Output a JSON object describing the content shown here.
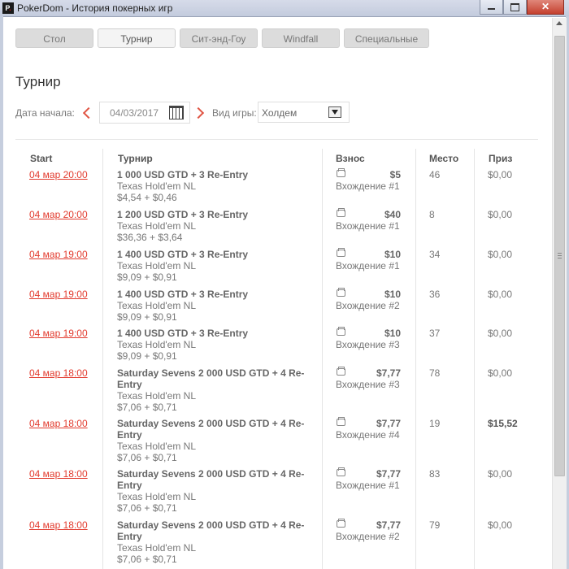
{
  "window": {
    "title": "PokerDom - История покерных игр",
    "close_label": "✕"
  },
  "tabs": [
    {
      "label": "Стол",
      "active": false
    },
    {
      "label": "Турнир",
      "active": true
    },
    {
      "label": "Сит-энд-Гоу",
      "active": false
    },
    {
      "label": "Windfall",
      "active": false
    },
    {
      "label": "Специальные",
      "active": false
    }
  ],
  "page_title": "Турнир",
  "filters": {
    "date_label": "Дата начала:",
    "date_value": "04/03/2017",
    "game_label": "Вид игры:",
    "game_value": "Холдем"
  },
  "table": {
    "headers": {
      "start": "Start",
      "tournament": "Турнир",
      "fee": "Взнос",
      "place": "Место",
      "prize": "Приз"
    },
    "rows": [
      {
        "start": "04 мар 20:00",
        "name": "1 000 USD GTD + 3 Re-Entry",
        "game": "Texas Hold'em NL",
        "buyin": "$4,54 + $0,46",
        "fee": "$5",
        "entry": "Вхождение #1",
        "place": "46",
        "prize": "$0,00"
      },
      {
        "start": "04 мар 20:00",
        "name": "1 200 USD GTD + 3 Re-Entry",
        "game": "Texas Hold'em NL",
        "buyin": "$36,36 + $3,64",
        "fee": "$40",
        "entry": "Вхождение #1",
        "place": "8",
        "prize": "$0,00"
      },
      {
        "start": "04 мар 19:00",
        "name": "1 400 USD GTD + 3 Re-Entry",
        "game": "Texas Hold'em NL",
        "buyin": "$9,09 + $0,91",
        "fee": "$10",
        "entry": "Вхождение #1",
        "place": "34",
        "prize": "$0,00"
      },
      {
        "start": "04 мар 19:00",
        "name": "1 400 USD GTD + 3 Re-Entry",
        "game": "Texas Hold'em NL",
        "buyin": "$9,09 + $0,91",
        "fee": "$10",
        "entry": "Вхождение #2",
        "place": "36",
        "prize": "$0,00"
      },
      {
        "start": "04 мар 19:00",
        "name": "1 400 USD GTD + 3 Re-Entry",
        "game": "Texas Hold'em NL",
        "buyin": "$9,09 + $0,91",
        "fee": "$10",
        "entry": "Вхождение #3",
        "place": "37",
        "prize": "$0,00"
      },
      {
        "start": "04 мар 18:00",
        "name": "Saturday Sevens 2 000 USD GTD + 4 Re-Entry",
        "game": "Texas Hold'em NL",
        "buyin": "$7,06 + $0,71",
        "fee": "$7,77",
        "entry": "Вхождение #3",
        "place": "78",
        "prize": "$0,00"
      },
      {
        "start": "04 мар 18:00",
        "name": "Saturday Sevens 2 000 USD GTD + 4 Re-Entry",
        "game": "Texas Hold'em NL",
        "buyin": "$7,06 + $0,71",
        "fee": "$7,77",
        "entry": "Вхождение #4",
        "place": "19",
        "prize": "$15,52"
      },
      {
        "start": "04 мар 18:00",
        "name": "Saturday Sevens 2 000 USD GTD + 4 Re-Entry",
        "game": "Texas Hold'em NL",
        "buyin": "$7,06 + $0,71",
        "fee": "$7,77",
        "entry": "Вхождение #1",
        "place": "83",
        "prize": "$0,00"
      },
      {
        "start": "04 мар 18:00",
        "name": "Saturday Sevens 2 000 USD GTD + 4 Re-Entry",
        "game": "Texas Hold'em NL",
        "buyin": "$7,06 + $0,71",
        "fee": "$7,77",
        "entry": "Вхождение #2",
        "place": "79",
        "prize": "$0,00"
      }
    ]
  }
}
